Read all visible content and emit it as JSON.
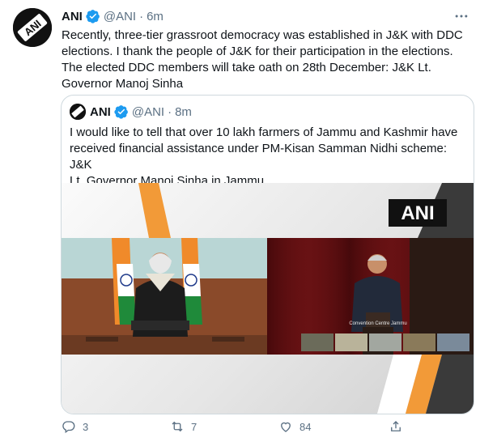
{
  "author": {
    "name": "ANI",
    "handle": "@ANI",
    "separator": "·",
    "time": "6m",
    "avatar_text": "ANI"
  },
  "tweet": {
    "text": "Recently, three-tier grassroot democracy was established in J&K with DDC\nelections. I thank the people of J&K for their participation in the elections.\nThe elected DDC members will take oath on 28th December: J&K Lt.\nGovernor Manoj Sinha"
  },
  "quoted": {
    "name": "ANI",
    "handle": "@ANI",
    "separator": "·",
    "time": "8m",
    "text": "I would like to tell that over 10 lakh farmers of Jammu and Kashmir have\nreceived financial assistance under PM-Kisan Samman Nidhi scheme: J&K\nLt. Governor Manoj Sinha in Jammu",
    "media": {
      "watermark": "ANI",
      "caption": "Convention Centre Jammu"
    }
  },
  "actions": {
    "reply_count": "3",
    "retweet_count": "7",
    "like_count": "84"
  },
  "colors": {
    "text": "#0f1419",
    "muted": "#5b7083",
    "verified": "#1d9bf0",
    "border": "#cfd9de"
  },
  "icons": [
    "ani-logo-icon",
    "verified-badge-icon",
    "more-options-icon",
    "reply-icon",
    "retweet-icon",
    "like-icon",
    "share-icon"
  ]
}
